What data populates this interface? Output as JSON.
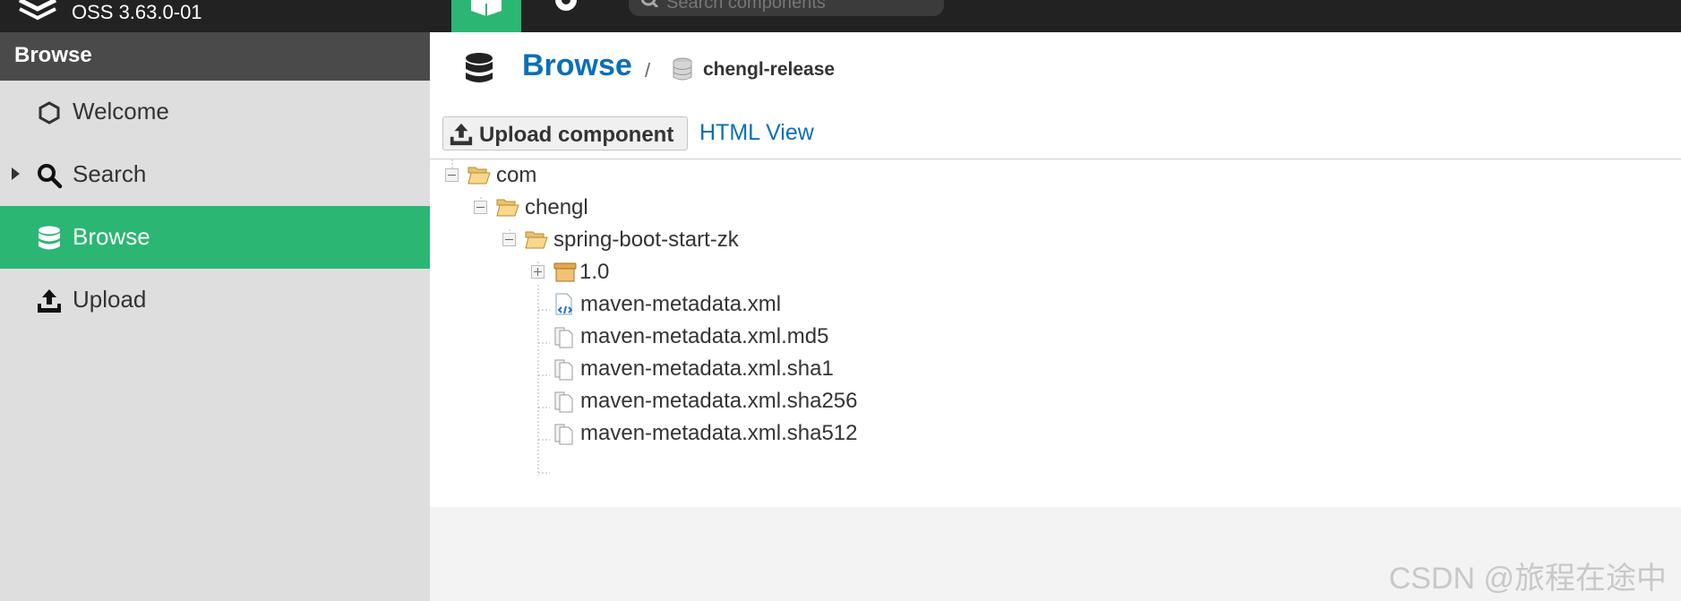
{
  "topbar": {
    "version": "OSS 3.63.0-01",
    "search_placeholder": "Search components"
  },
  "sidebar": {
    "header": "Browse",
    "items": [
      {
        "label": "Welcome",
        "icon": "hexagon-icon"
      },
      {
        "label": "Search",
        "icon": "search-icon"
      },
      {
        "label": "Browse",
        "icon": "database-icon",
        "active": true
      },
      {
        "label": "Upload",
        "icon": "upload-icon"
      }
    ]
  },
  "breadcrumb": {
    "title": "Browse",
    "separator": "/",
    "repository": "chengl-release"
  },
  "toolbar": {
    "upload_label": "Upload component",
    "html_view_label": "HTML View"
  },
  "tree": [
    {
      "label": "com",
      "type": "folder-open"
    },
    {
      "label": "chengl",
      "type": "folder-open"
    },
    {
      "label": "spring-boot-start-zk",
      "type": "folder-open"
    },
    {
      "label": "1.0",
      "type": "component-box"
    },
    {
      "label": "maven-metadata.xml",
      "type": "xml-file"
    },
    {
      "label": "maven-metadata.xml.md5",
      "type": "file"
    },
    {
      "label": "maven-metadata.xml.sha1",
      "type": "file"
    },
    {
      "label": "maven-metadata.xml.sha256",
      "type": "file"
    },
    {
      "label": "maven-metadata.xml.sha512",
      "type": "file"
    }
  ],
  "watermark": "CSDN @旅程在途中",
  "colors": {
    "accent_green": "#2bb673",
    "link_blue": "#0a6fb8",
    "topbar_bg": "#222222",
    "sidebar_bg": "#dedede"
  }
}
